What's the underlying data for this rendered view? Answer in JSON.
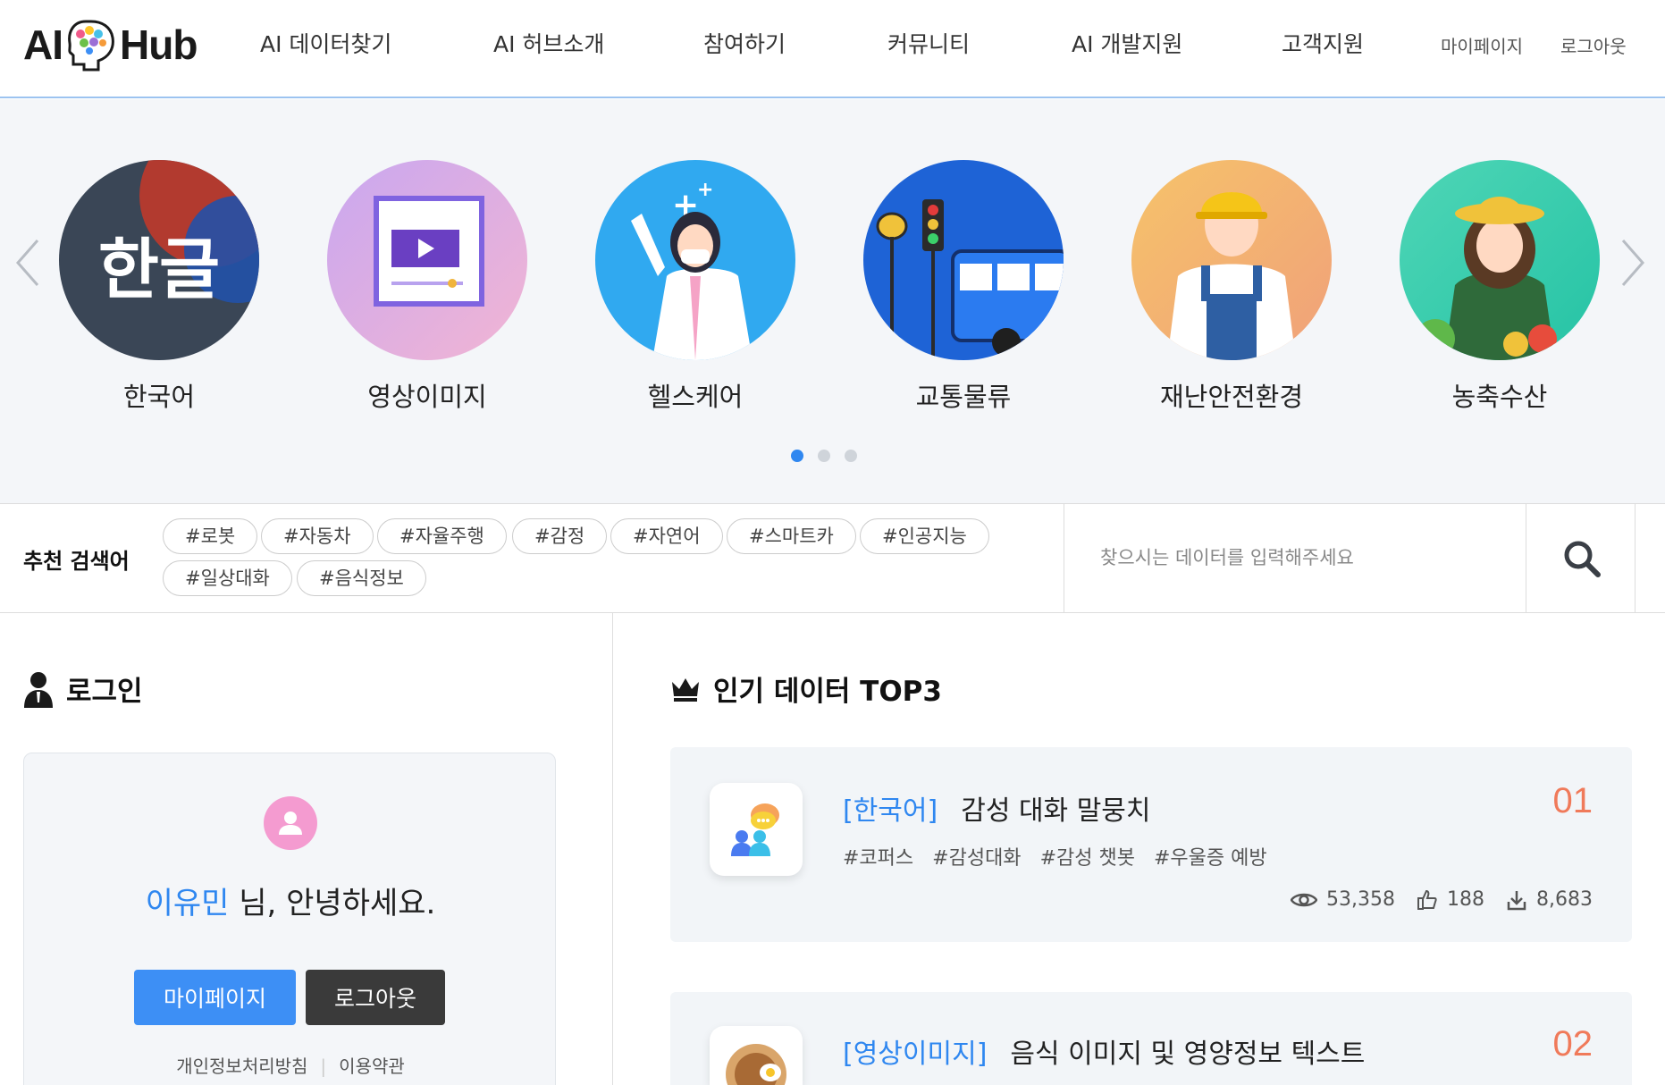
{
  "header": {
    "logo_left": "AI",
    "logo_right": "Hub",
    "nav": [
      "AI 데이터찾기",
      "AI 허브소개",
      "참여하기",
      "커뮤니티",
      "AI 개발지원",
      "고객지원"
    ],
    "util": [
      "마이페이지",
      "로그아웃"
    ]
  },
  "categories": [
    {
      "label": "한국어",
      "icon": "hangul-icon",
      "art_text": "한글"
    },
    {
      "label": "영상이미지",
      "icon": "video-image-icon"
    },
    {
      "label": "헬스케어",
      "icon": "doctor-icon"
    },
    {
      "label": "교통물류",
      "icon": "bus-traffic-icon"
    },
    {
      "label": "재난안전환경",
      "icon": "worker-icon"
    },
    {
      "label": "농축수산",
      "icon": "farmer-icon"
    }
  ],
  "slider": {
    "page_count": 3,
    "active_page": 1
  },
  "recommend": {
    "title": "추천 검색어",
    "tags": [
      "#로봇",
      "#자동차",
      "#자율주행",
      "#감정",
      "#자연어",
      "#스마트카",
      "#인공지능",
      "#일상대화",
      "#음식정보"
    ]
  },
  "search": {
    "placeholder": "찾으시는 데이터를 입력해주세요",
    "value": ""
  },
  "login": {
    "title": "로그인",
    "user_name": "이유민",
    "greeting_suffix": " 님, 안녕하세요.",
    "mypage_btn": "마이페이지",
    "logout_btn": "로그아웃",
    "privacy_link": "개인정보처리방침",
    "terms_link": "이용약관"
  },
  "top3": {
    "title": "인기 데이터 TOP3",
    "items": [
      {
        "rank": "01",
        "category": "[한국어]",
        "title": "감성 대화 말뭉치",
        "tags": [
          "#코퍼스",
          "#감성대화",
          "#감성 챗봇",
          "#우울증 예방"
        ],
        "views": "53,358",
        "likes": "188",
        "downloads": "8,683"
      },
      {
        "rank": "02",
        "category": "[영상이미지]",
        "title": "음식 이미지 및 영양정보 텍스트"
      }
    ]
  },
  "colors": {
    "accent": "#2f87f0",
    "rank": "#f07a5a",
    "avatar": "#f49bd0"
  }
}
